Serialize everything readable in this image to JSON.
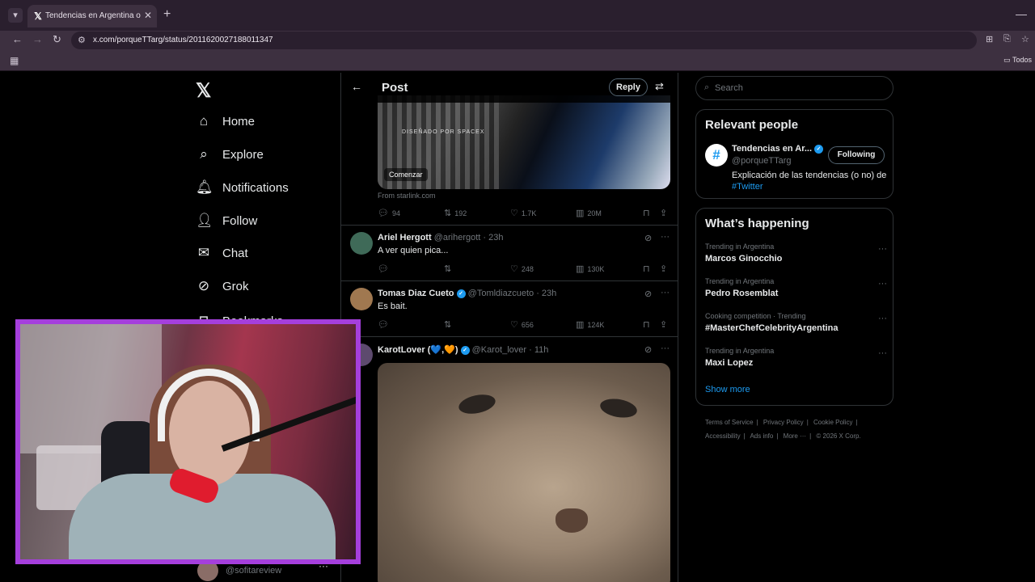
{
  "browser": {
    "tab_title": "Tendencias en Argentina on X: \"",
    "url": "x.com/porqueTTarg/status/2011620027188011347",
    "bookmarks_all": "Todos"
  },
  "nav": {
    "home": "Home",
    "explore": "Explore",
    "notifications": "Notifications",
    "follow": "Follow",
    "chat": "Chat",
    "grok": "Grok",
    "bookmarks": "Bookmarks",
    "account_handle": "@sofitareview"
  },
  "post": {
    "title": "Post",
    "reply_button": "Reply",
    "card": {
      "brand": "DISEÑADO POR SPACEX",
      "cta": "Comenzar",
      "source": "From starlink.com"
    },
    "stats": {
      "replies": "94",
      "reposts": "192",
      "likes": "1.7K",
      "views": "20M"
    }
  },
  "replies": [
    {
      "name": "Ariel Hergott",
      "handle": "@arihergott",
      "time": "23h",
      "text": "A ver quien pica...",
      "likes": "248",
      "views": "130K",
      "verified": false
    },
    {
      "name": "Tomas Diaz Cueto",
      "handle": "@Tomldiazcueto",
      "time": "23h",
      "text": "Es bait.",
      "likes": "656",
      "views": "124K",
      "verified": true
    },
    {
      "name": "KarotLover (💙,🧡)",
      "handle": "@Karot_lover",
      "time": "11h",
      "text": "",
      "verified": true
    }
  ],
  "search": {
    "placeholder": "Search"
  },
  "relevant": {
    "title": "Relevant people",
    "name": "Tendencias en Ar...",
    "handle": "@porqueTTarg",
    "button": "Following",
    "bio": "Explicación de las tendencias (o no) de ",
    "bio_link": "#Twitter"
  },
  "happening": {
    "title": "What’s happening",
    "trends": [
      {
        "context": "Trending in Argentina",
        "name": "Marcos Ginocchio"
      },
      {
        "context": "Trending in Argentina",
        "name": "Pedro Rosemblat"
      },
      {
        "context": "Cooking competition · Trending",
        "name": "#MasterChefCelebrityArgentina"
      },
      {
        "context": "Trending in Argentina",
        "name": "Maxi Lopez"
      }
    ],
    "show_more": "Show more"
  },
  "footer": {
    "terms": "Terms of Service",
    "privacy": "Privacy Policy",
    "cookie": "Cookie Policy",
    "accessibility": "Accessibility",
    "ads": "Ads info",
    "more": "More ···",
    "copyright": "© 2026 X Corp."
  },
  "colors": {
    "accent": "#1d9bf0",
    "cam_border": "#a53fdc",
    "background": "#000000"
  }
}
